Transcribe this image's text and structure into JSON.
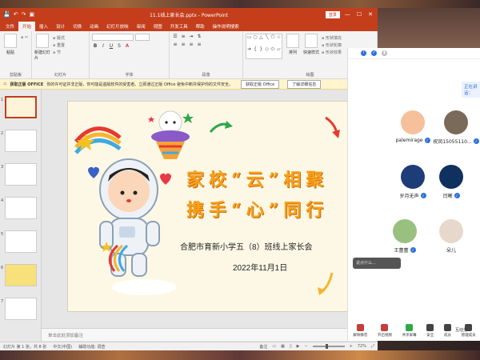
{
  "window": {
    "title": "11.1线上家长会.pptx - PowerPoint",
    "login": "登录",
    "ctrl_min": "—",
    "ctrl_max": "☐",
    "ctrl_close": "✕"
  },
  "ribbon_tabs": [
    {
      "label": "文件"
    },
    {
      "label": "开始"
    },
    {
      "label": "插入"
    },
    {
      "label": "设计"
    },
    {
      "label": "切换"
    },
    {
      "label": "动画"
    },
    {
      "label": "幻灯片放映"
    },
    {
      "label": "审阅"
    },
    {
      "label": "视图"
    },
    {
      "label": "开发工具"
    },
    {
      "label": "帮助"
    },
    {
      "label": "操作说明搜索"
    }
  ],
  "ribbon": {
    "paste": "粘贴",
    "new_slide": "新建幻灯片",
    "reuse": "重用幻灯片",
    "layout": "版式",
    "reset": "重置",
    "section": "节",
    "group_clipboard": "剪贴板",
    "group_slides": "幻灯片",
    "group_font": "字体",
    "group_paragraph": "段落",
    "group_drawing": "绘图",
    "arrange": "排列",
    "quick_styles": "快速样式",
    "fill": "形状填充",
    "outline": "形状轮廓",
    "effects": "形状效果"
  },
  "notice": {
    "strong": "获取正版 OFFICE",
    "text": "你的许可证并非正版，你可能是盗版软件的受害者。立即通过正版 Office 避免中断并保护你的文件安全。",
    "btn1": "获取正版 Office",
    "btn2": "了解详细信息",
    "close": "✕"
  },
  "slides": {
    "thumb_numbers": [
      "1",
      "2",
      "3",
      "4",
      "5",
      "6",
      "7"
    ]
  },
  "slide": {
    "title_line1": "家校“云”相聚",
    "title_line2": "携手“心”同行",
    "subtitle": "合肥市育新小学五（8）班线上家长会",
    "date": "2022年11月1日"
  },
  "notes_placeholder": "单击此处添加备注",
  "status": {
    "slide_pos": "幻灯片 第 1 张，共 8 张",
    "lang": "中文(中国)",
    "accessibility": "辅助功能: 调查",
    "notes": "备注",
    "zoom": "72%",
    "zoom_fraction": 0.72
  },
  "meeting": {
    "speaking": "正在讲话：",
    "chat_placeholder": "说点什么...",
    "participants": [
      {
        "name": "palemirage",
        "avatar_color": "#f6c09a"
      },
      {
        "name": "祝凤15055110...",
        "avatar_color": "#7a6a5a"
      },
      {
        "name": "岁月无声",
        "avatar_color": "#1e3c78"
      },
      {
        "name": "闫曦",
        "avatar_color": "#103060"
      },
      {
        "name": "王蕾蕾",
        "avatar_color": "#9ac080"
      },
      {
        "name": "朵儿",
        "avatar_color": "#e8d8cc"
      }
    ],
    "toolbar": [
      {
        "label": "解除静音"
      },
      {
        "label": "开启视频"
      },
      {
        "label": "共享屏幕"
      },
      {
        "label": "安全"
      },
      {
        "label": "成员"
      },
      {
        "label": "管理成员"
      }
    ],
    "extra": "互动分"
  }
}
